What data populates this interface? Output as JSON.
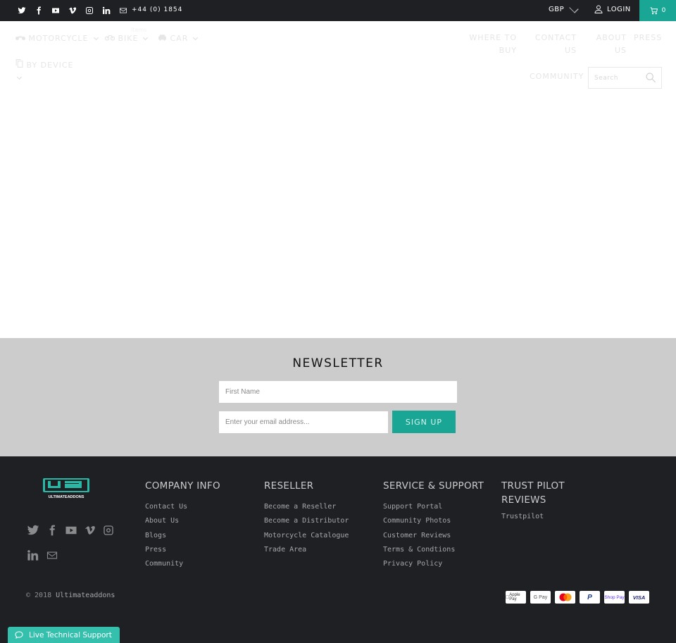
{
  "topbar": {
    "social_icons": [
      "twitter-icon",
      "facebook-icon",
      "youtube-icon",
      "vimeo-icon",
      "instagram-icon",
      "linkedin-icon",
      "email-icon"
    ],
    "phone": "+44 (0) 1854",
    "currency": "GBP",
    "login_label": "LOGIN",
    "cart_count": "0"
  },
  "nav": {
    "left": [
      {
        "label": "MOTORCYCLE",
        "icon": "motorcycle-icon"
      },
      {
        "label": "BIKE",
        "icon": "bicycle-icon"
      },
      {
        "label": "CAR",
        "icon": "car-icon"
      },
      {
        "label": "BY DEVICE",
        "icon": "device-icon"
      }
    ],
    "faint_label": "Items",
    "right": [
      {
        "line1": "WHERE TO",
        "line2": "BUY"
      },
      {
        "line1": "CONTACT",
        "line2": "US"
      },
      {
        "line1": "ABOUT",
        "line2": "US"
      },
      {
        "line1": "PRESS",
        "line2": ""
      }
    ],
    "community": "COMMUNITY",
    "search_placeholder": "Search"
  },
  "newsletter": {
    "title": "NEWSLETTER",
    "first_name_placeholder": "First Name",
    "email_placeholder": "Enter your email address...",
    "signup_label": "SIGN UP"
  },
  "footer": {
    "logo_text": "ULTIMATEADDONS",
    "columns": [
      {
        "title": "COMPANY INFO",
        "links": [
          "Contact Us",
          "About Us",
          "Blogs",
          "Press",
          "Community"
        ]
      },
      {
        "title": "RESELLER",
        "links": [
          "Become a Reseller",
          "Become a Distributor",
          "Motorcycle Catalogue",
          "Trade Area"
        ]
      },
      {
        "title": "SERVICE & SUPPORT",
        "links": [
          "Support Portal",
          "Community Photos",
          "Customer Reviews",
          "Terms & Condtions",
          "Privacy Policy"
        ]
      },
      {
        "title_line1": "TRUST PILOT",
        "title_line2": "REVIEWS",
        "links": [
          "Trustpilot"
        ]
      }
    ],
    "copyright_prefix": "© 2018",
    "copyright_link": "Ultimateaddons",
    "payments": [
      "Apple Pay",
      "G Pay",
      "Mastercard",
      "PayPal",
      "Shop Pay",
      "VISA"
    ],
    "accent": "#1aa695"
  },
  "live_support": {
    "label": "Live Technical Support"
  }
}
